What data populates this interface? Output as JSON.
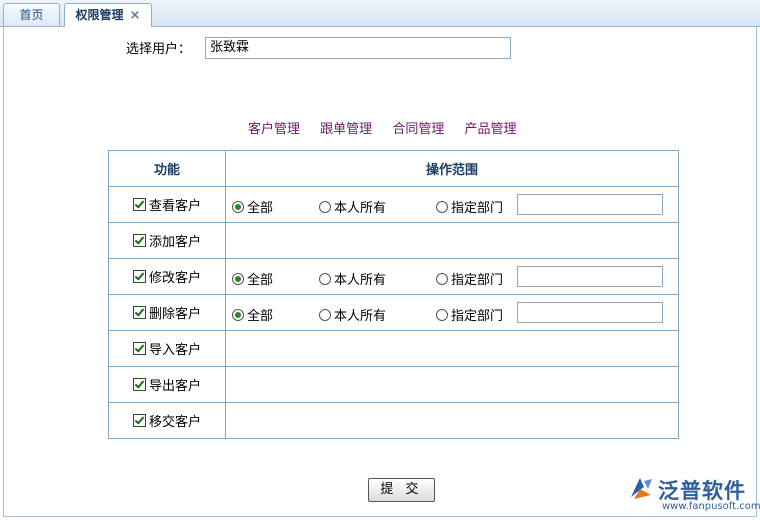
{
  "tabs": [
    {
      "label": "首页",
      "active": false
    },
    {
      "label": "权限管理",
      "active": true,
      "close_icon": "×"
    }
  ],
  "user_select": {
    "label": "选择用户：",
    "value": "张致霖"
  },
  "modules": [
    "客户管理",
    "跟单管理",
    "合同管理",
    "产品管理"
  ],
  "table": {
    "headers": {
      "function": "功能",
      "scope": "操作范围"
    },
    "rows": [
      {
        "label": "查看客户",
        "checked": true,
        "has_scope": true
      },
      {
        "label": "添加客户",
        "checked": true,
        "has_scope": false
      },
      {
        "label": "修改客户",
        "checked": true,
        "has_scope": true
      },
      {
        "label": "删除客户",
        "checked": true,
        "has_scope": true
      },
      {
        "label": "导入客户",
        "checked": true,
        "has_scope": false
      },
      {
        "label": "导出客户",
        "checked": true,
        "has_scope": false
      },
      {
        "label": "移交客户",
        "checked": true,
        "has_scope": false
      }
    ],
    "scope_options": [
      "全部",
      "本人所有",
      "指定部门"
    ],
    "scope_selected": "全部"
  },
  "submit_label": "提 交",
  "logo": {
    "name": "泛普软件",
    "url": "www.fanpusoft.com"
  },
  "colors": {
    "accent": "#2c5f9e",
    "border": "#7fa9c9",
    "module_link": "#6a1a6a"
  }
}
